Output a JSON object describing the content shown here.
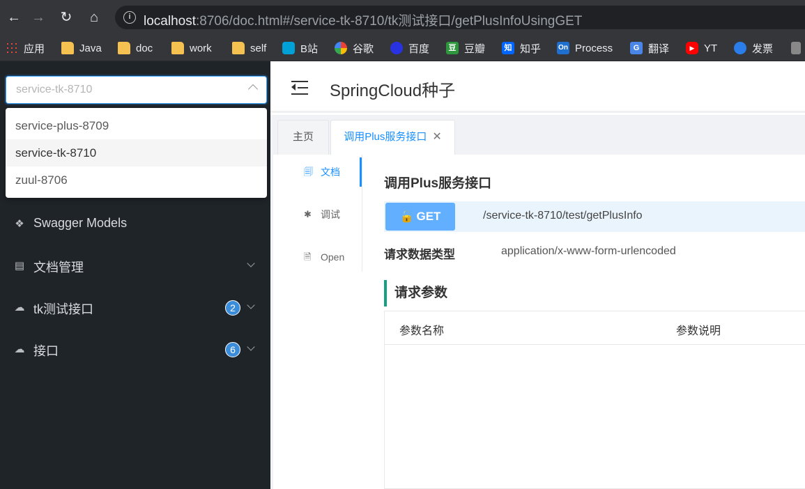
{
  "browser": {
    "url_host": "localhost",
    "url_rest": ":8706/doc.html#/service-tk-8710/tk测试接口/getPlusInfoUsingGET",
    "bookmarks": [
      {
        "label": "应用",
        "icon": "apps-grid-icon"
      },
      {
        "label": "Java",
        "icon": "folder-icon"
      },
      {
        "label": "doc",
        "icon": "folder-icon"
      },
      {
        "label": "work",
        "icon": "folder-icon"
      },
      {
        "label": "self",
        "icon": "folder-icon"
      },
      {
        "label": "B站",
        "icon": "bilibili-icon"
      },
      {
        "label": "谷歌",
        "icon": "google-icon"
      },
      {
        "label": "百度",
        "icon": "baidu-icon"
      },
      {
        "label": "豆瓣",
        "icon": "douban-icon"
      },
      {
        "label": "知乎",
        "icon": "zhihu-icon"
      },
      {
        "label": "Process",
        "icon": "processon-icon"
      },
      {
        "label": "翻译",
        "icon": "translate-icon"
      },
      {
        "label": "YT",
        "icon": "youtube-icon"
      },
      {
        "label": "发票",
        "icon": "search-icon"
      }
    ],
    "icon_text": {
      "douban": "豆",
      "zhihu": "知",
      "processon": "On",
      "translate": "G"
    }
  },
  "sidebar": {
    "select_value": "service-tk-8710",
    "options": [
      "service-plus-8709",
      "service-tk-8710",
      "zuul-8706"
    ],
    "selected_index": 1,
    "menu": [
      {
        "label": "Swagger Models",
        "icon": "cube-icon"
      },
      {
        "label": "文档管理",
        "icon": "doc-settings-icon",
        "expandable": true
      },
      {
        "label": "tk测试接口",
        "icon": "cloud-icon",
        "badge": "2",
        "expandable": true
      },
      {
        "label": "接口",
        "icon": "cloud-icon",
        "badge": "6",
        "expandable": true
      }
    ]
  },
  "header": {
    "title": "SpringCloud种子"
  },
  "tabs": [
    {
      "label": "主页",
      "active": false
    },
    {
      "label": "调用Plus服务接口",
      "active": true,
      "closable": true
    }
  ],
  "doc_tabs": [
    {
      "label": "文档",
      "icon": "document-icon",
      "active": true
    },
    {
      "label": "调试",
      "icon": "bug-icon",
      "active": false
    },
    {
      "label": "Open",
      "icon": "file-icon",
      "active": false
    }
  ],
  "api": {
    "title": "调用Plus服务接口",
    "method": "GET",
    "path": "/service-tk-8710/test/getPlusInfo",
    "content_type_label": "请求数据类型",
    "content_type_value": "application/x-www-form-urlencoded",
    "params_section_title": "请求参数",
    "params_columns": [
      "参数名称",
      "参数说明"
    ]
  },
  "colors": {
    "sidebar_bg": "#1f2429",
    "accent": "#1890ff",
    "get_method": "#61affe",
    "section_marker": "#12a182",
    "badge": "#3c8dd9"
  }
}
